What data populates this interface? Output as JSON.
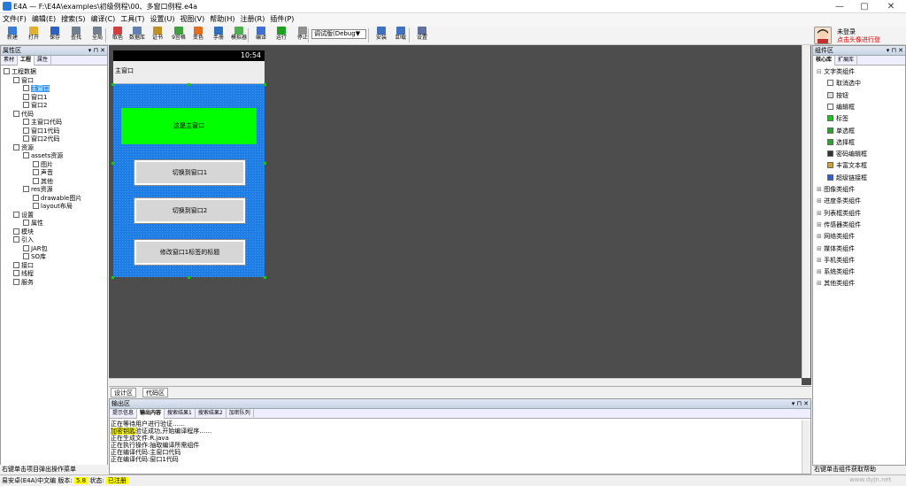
{
  "window": {
    "title": "E4A — F:\\E4A\\examples\\初级例程\\00、多窗口例程.e4a",
    "min": "—",
    "max": "▢",
    "close": "✕"
  },
  "menu": [
    "文件(F)",
    "编辑(E)",
    "搜索(S)",
    "编译(C)",
    "工具(T)",
    "设置(U)",
    "视图(V)",
    "帮助(H)",
    "注册(R)",
    "插件(P)"
  ],
  "toolbar": [
    {
      "label": "新建",
      "color": "#3b7dd8"
    },
    {
      "label": "打开",
      "color": "#e0b030"
    },
    {
      "label": "保存",
      "color": "#3060c0"
    },
    {
      "label": "查找",
      "color": "#708090"
    },
    {
      "label": "全局",
      "color": "#708090"
    },
    {
      "label": "取色",
      "color": "#d04040"
    },
    {
      "label": "数据库",
      "color": "#6080b0"
    },
    {
      "label": "证书",
      "color": "#c09020"
    },
    {
      "label": "9宫格",
      "color": "#40a040"
    },
    {
      "label": "变色",
      "color": "#e07020"
    },
    {
      "label": "手册",
      "color": "#3070c0"
    },
    {
      "label": "模拟器",
      "color": "#50b050"
    },
    {
      "label": "编译",
      "color": "#4070d0"
    },
    {
      "label": "运行",
      "color": "#20a020"
    },
    {
      "label": "停止",
      "color": "#909090"
    },
    {
      "label": "安装",
      "color": "#4070c0"
    },
    {
      "label": "卸载",
      "color": "#4070c0"
    },
    {
      "label": "设置",
      "color": "#6070a0"
    }
  ],
  "build_select": "调试版(Debug▼",
  "user": {
    "status": "未登录",
    "hint": "点击头像进行登"
  },
  "left_panel": {
    "title": "属性区",
    "controls": "▾ ⊓ ✕",
    "tabs": [
      "素材",
      "工程",
      "属性"
    ],
    "active_tab": 1,
    "footer": "右键单击项目弹出操作菜单",
    "tree": [
      {
        "label": "工程数据",
        "level": 0
      },
      {
        "label": "窗口",
        "level": 1
      },
      {
        "label": "主窗口",
        "level": 2,
        "selected": true
      },
      {
        "label": "窗口1",
        "level": 2
      },
      {
        "label": "窗口2",
        "level": 2
      },
      {
        "label": "代码",
        "level": 1
      },
      {
        "label": "主窗口代码",
        "level": 2
      },
      {
        "label": "窗口1代码",
        "level": 2
      },
      {
        "label": "窗口2代码",
        "level": 2
      },
      {
        "label": "资源",
        "level": 1
      },
      {
        "label": "assets资源",
        "level": 2
      },
      {
        "label": "图片",
        "level": 3
      },
      {
        "label": "声音",
        "level": 3
      },
      {
        "label": "其他",
        "level": 3
      },
      {
        "label": "res资源",
        "level": 2
      },
      {
        "label": "drawable图片",
        "level": 3
      },
      {
        "label": "layout布局",
        "level": 3
      },
      {
        "label": "设置",
        "level": 1
      },
      {
        "label": "属性",
        "level": 2
      },
      {
        "label": "模块",
        "level": 1
      },
      {
        "label": "引入",
        "level": 1
      },
      {
        "label": "JAR包",
        "level": 2
      },
      {
        "label": "SO库",
        "level": 2
      },
      {
        "label": "接口",
        "level": 1
      },
      {
        "label": "线程",
        "level": 1
      },
      {
        "label": "服务",
        "level": 1
      }
    ]
  },
  "phone": {
    "time": "10:54",
    "window_title": "主窗口",
    "label": "这是主窗口",
    "buttons": [
      "切换到窗口1",
      "切换到窗口2",
      "修改窗口1标签的标题"
    ]
  },
  "editor_tabs": [
    "设计区",
    "代码区"
  ],
  "output": {
    "title": "输出区",
    "controls": "▾ ⊓ ✕",
    "tabs": [
      "提示信息",
      "输出内容",
      "搜索结果1",
      "搜索结果2",
      "加密队列"
    ],
    "active_tab": 1,
    "lines": [
      "正在等待用户进行验证……",
      "加密钥匙验证成功,开始编译程序……",
      "正在生成文件:R.java",
      "正在执行操作:抽取编译所需组件",
      "正在编译代码:主窗口代码",
      "正在编译代码:窗口1代码"
    ]
  },
  "right_panel": {
    "title": "组件区",
    "controls": "▾ ⊓ ✕",
    "tabs": [
      "核心库",
      "扩展库"
    ],
    "active_tab": 0,
    "footer": "右键单击组件获取帮助",
    "groups": [
      {
        "label": "文字类组件",
        "expanded": true,
        "items": [
          {
            "label": "取消选中",
            "color": "#ffffff"
          },
          {
            "label": "按钮",
            "color": "#dddddd"
          },
          {
            "label": "编辑框",
            "color": "#ffffff"
          },
          {
            "label": "标签",
            "color": "#20c020"
          },
          {
            "label": "单选框",
            "color": "#30a030"
          },
          {
            "label": "选择框",
            "color": "#30a030"
          },
          {
            "label": "密码编辑框",
            "color": "#333333"
          },
          {
            "label": "丰富文本框",
            "color": "#d0a040"
          },
          {
            "label": "超级链接框",
            "color": "#3060c0"
          }
        ]
      },
      {
        "label": "图像类组件"
      },
      {
        "label": "进度条类组件"
      },
      {
        "label": "列表框类组件"
      },
      {
        "label": "传感器类组件"
      },
      {
        "label": "网络类组件"
      },
      {
        "label": "媒体类组件"
      },
      {
        "label": "手机类组件"
      },
      {
        "label": "系统类组件"
      },
      {
        "label": "其他类组件"
      }
    ]
  },
  "statusbar": {
    "text1": "易安卓(E4A)中文编 版本:",
    "version": "5.8",
    "text2": "状态:",
    "state": "已注册"
  },
  "watermark": "www.dyjn.net"
}
